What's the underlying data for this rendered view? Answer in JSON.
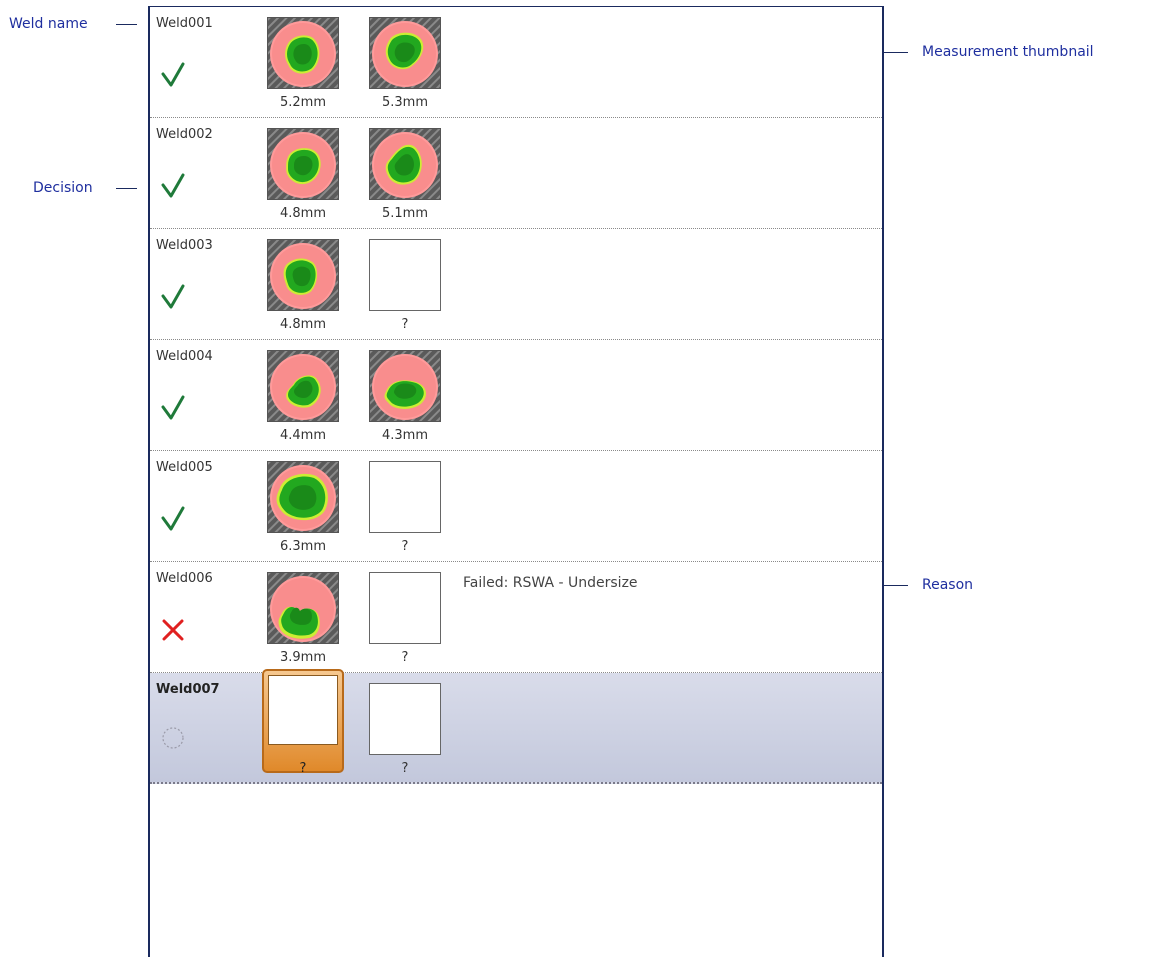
{
  "callouts": {
    "weld_name": "Weld name",
    "decision": "Decision",
    "measurement_thumbnail": "Measurement thumbnail",
    "reason": "Reason"
  },
  "colors": {
    "accent": "#1f2f9f",
    "pass": "#1f7a3a",
    "fail": "#e02020",
    "selected_row": "#c8cce0",
    "focus": "#e0892a"
  },
  "welds": [
    {
      "name": "Weld001",
      "decision": "pass",
      "m1": "5.2mm",
      "m2": "5.3mm",
      "reason": ""
    },
    {
      "name": "Weld002",
      "decision": "pass",
      "m1": "4.8mm",
      "m2": "5.1mm",
      "reason": ""
    },
    {
      "name": "Weld003",
      "decision": "pass",
      "m1": "4.8mm",
      "m2": "?",
      "reason": ""
    },
    {
      "name": "Weld004",
      "decision": "pass",
      "m1": "4.4mm",
      "m2": "4.3mm",
      "reason": ""
    },
    {
      "name": "Weld005",
      "decision": "pass",
      "m1": "6.3mm",
      "m2": "?",
      "reason": ""
    },
    {
      "name": "Weld006",
      "decision": "fail",
      "m1": "3.9mm",
      "m2": "?",
      "reason": "Failed: RSWA - Undersize"
    },
    {
      "name": "Weld007",
      "decision": "pending",
      "m1": "?",
      "m2": "?",
      "reason": ""
    }
  ]
}
